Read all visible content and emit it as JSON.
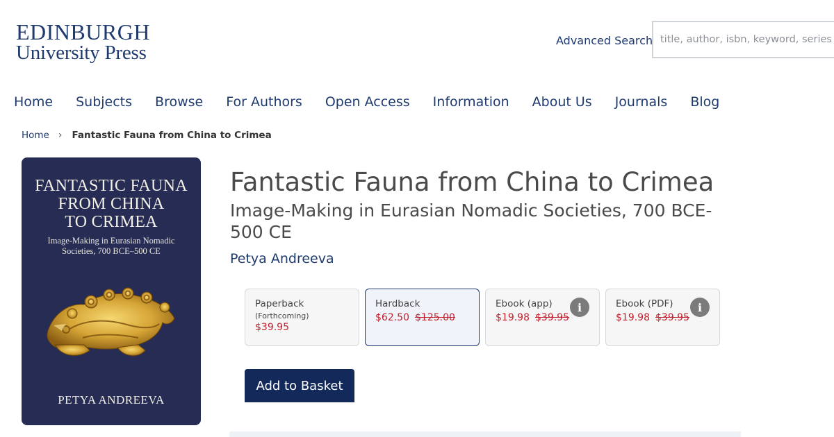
{
  "logo": {
    "line1": "EDINBURGH",
    "line2": "University Press"
  },
  "header": {
    "advanced_search": "Advanced Search",
    "search_placeholder": "title, author, isbn, keyword, series"
  },
  "nav": {
    "items": [
      "Home",
      "Subjects",
      "Browse",
      "For Authors",
      "Open Access",
      "Information",
      "About Us",
      "Journals",
      "Blog"
    ]
  },
  "breadcrumb": {
    "home": "Home",
    "separator": "›",
    "current": "Fantastic Fauna from China to Crimea"
  },
  "cover": {
    "title_line1": "FANTASTIC FAUNA",
    "title_line2": "FROM CHINA",
    "title_line3": "TO CRIMEA",
    "subtitle_line1": "Image-Making in Eurasian Nomadic",
    "subtitle_line2": "Societies, 700 BCE–500 CE",
    "author": "PETYA ANDREEVA",
    "background_color": "#272c55"
  },
  "book": {
    "title": "Fantastic Fauna from China to Crimea",
    "subtitle": "Image-Making in Eurasian Nomadic Societies, 700 BCE-500 CE",
    "author": "Petya Andreeva"
  },
  "formats": [
    {
      "name": "Paperback",
      "note": "(Forthcoming)",
      "price": "$39.95",
      "old_price": "",
      "info": false,
      "selected": false
    },
    {
      "name": "Hardback",
      "note": "",
      "price": "$62.50",
      "old_price": "$125.00",
      "info": false,
      "selected": true
    },
    {
      "name": "Ebook (app)",
      "note": "",
      "price": "$19.98",
      "old_price": "$39.95",
      "info": true,
      "selected": false
    },
    {
      "name": "Ebook (PDF)",
      "note": "",
      "price": "$19.98",
      "old_price": "$39.95",
      "info": true,
      "selected": false
    }
  ],
  "info_icon_glyph": "i",
  "actions": {
    "add_to_basket": "Add to Basket"
  },
  "colors": {
    "brand_navy": "#1e3a6e",
    "button": "#13295a",
    "price_red": "#c0202e"
  },
  "icons": {
    "info": "info-icon",
    "breadcrumb_separator": "chevron-right-icon"
  }
}
